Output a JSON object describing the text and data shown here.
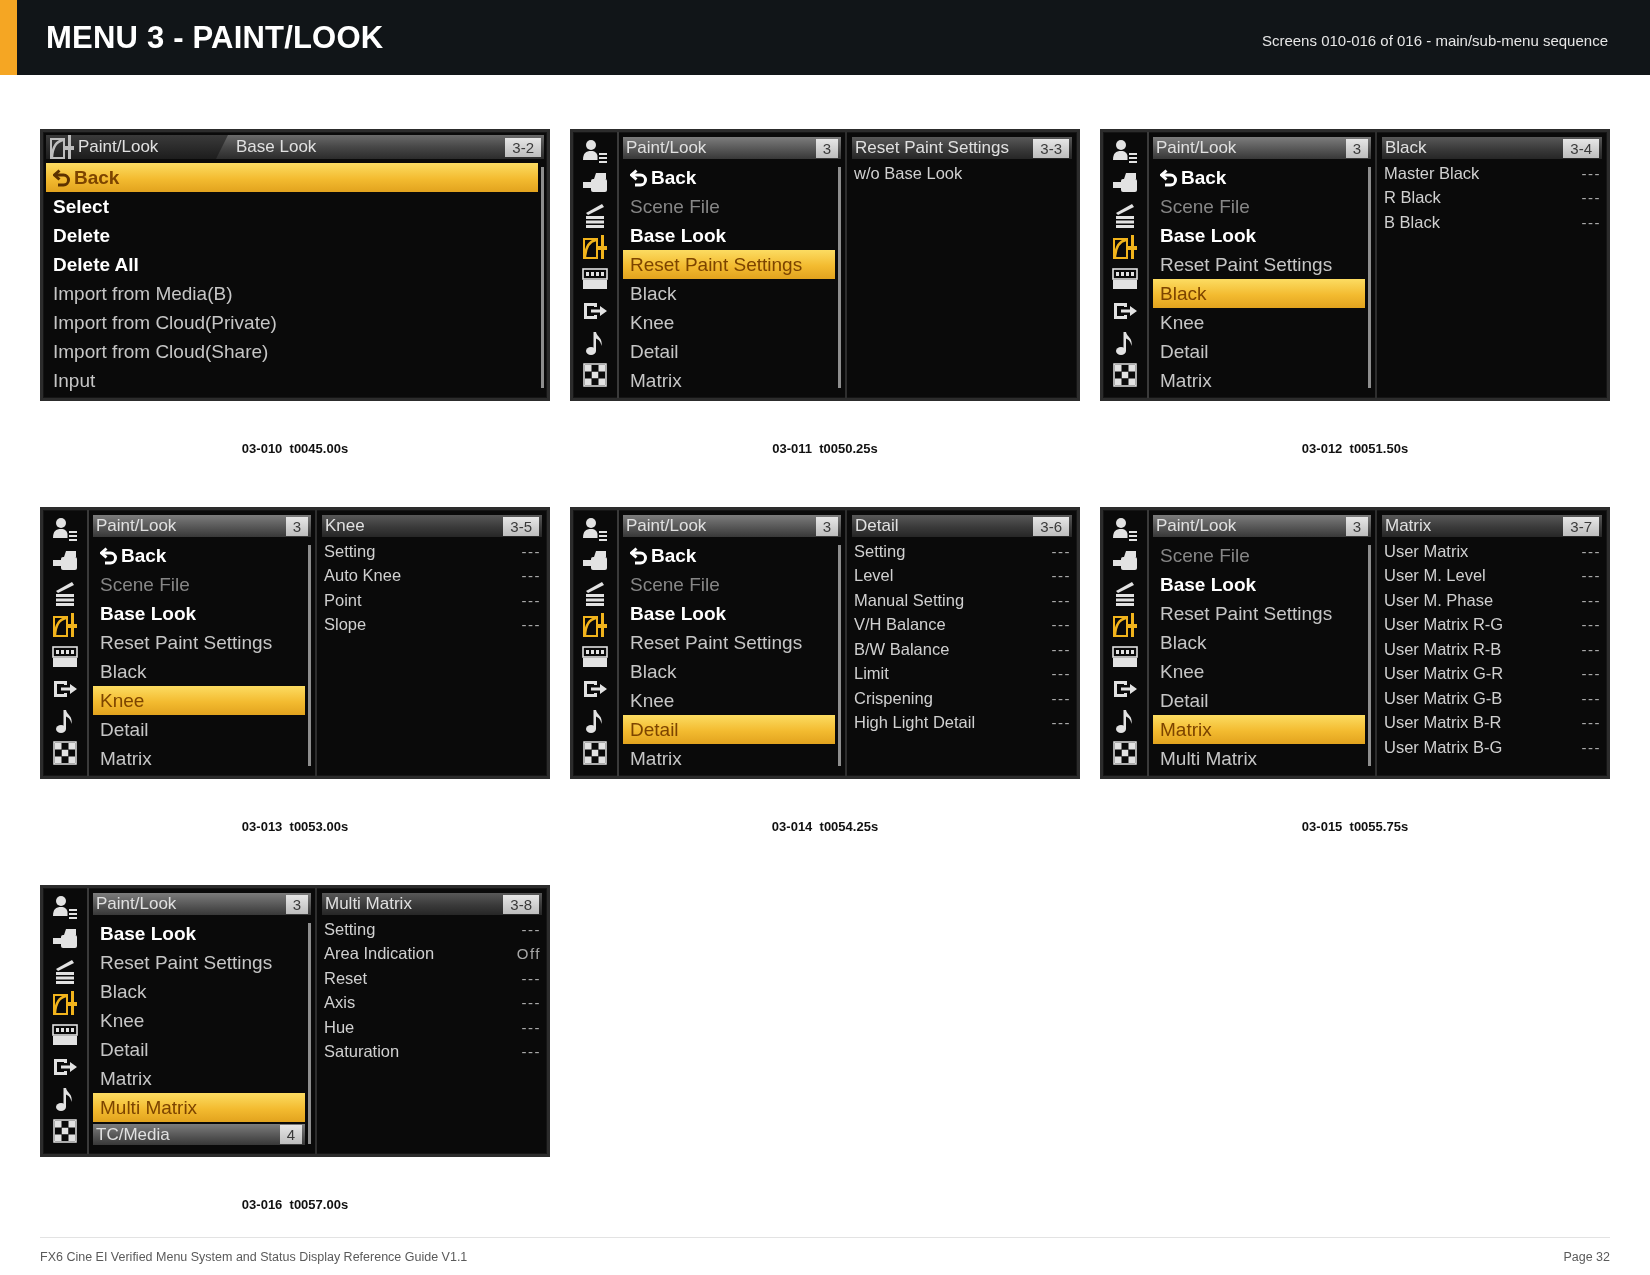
{
  "header": {
    "title": "MENU 3 - PAINT/LOOK",
    "subtitle": "Screens 010-016 of 016 - main/sub-menu sequence"
  },
  "screens": [
    {
      "kind": "single",
      "menu": {
        "section": "Paint/Look",
        "title": "Base Look",
        "number": "3-2",
        "items": [
          {
            "kind": "back",
            "label": "Back",
            "emphasized": true,
            "disabled": false,
            "selected": true
          },
          {
            "kind": "item",
            "label": "Select",
            "emphasized": true,
            "disabled": false,
            "selected": false
          },
          {
            "kind": "item",
            "label": "Delete",
            "emphasized": true,
            "disabled": false,
            "selected": false
          },
          {
            "kind": "item",
            "label": "Delete All",
            "emphasized": true,
            "disabled": false,
            "selected": false
          },
          {
            "kind": "item",
            "label": "Import from Media(B)",
            "emphasized": false,
            "disabled": false,
            "selected": false
          },
          {
            "kind": "item",
            "label": "Import from Cloud(Private)",
            "emphasized": false,
            "disabled": false,
            "selected": false
          },
          {
            "kind": "item",
            "label": "Import from Cloud(Share)",
            "emphasized": false,
            "disabled": false,
            "selected": false
          },
          {
            "kind": "item",
            "label": "Input",
            "emphasized": false,
            "disabled": false,
            "selected": false
          }
        ]
      },
      "caption": "03-010  t0045.00s"
    },
    {
      "kind": "split",
      "side_icons": [
        {
          "kind": "user",
          "selected": false
        },
        {
          "kind": "camera",
          "selected": false
        },
        {
          "kind": "clapper",
          "selected": false
        },
        {
          "kind": "paint",
          "selected": true
        },
        {
          "kind": "timecode",
          "selected": false
        },
        {
          "kind": "output",
          "selected": false
        },
        {
          "kind": "audio",
          "selected": false
        },
        {
          "kind": "grid",
          "selected": false
        }
      ],
      "menu": {
        "title": "Paint/Look",
        "number": "3",
        "items": [
          {
            "kind": "back",
            "label": "Back",
            "emphasized": true,
            "disabled": false,
            "selected": false
          },
          {
            "kind": "item",
            "label": "Scene File",
            "emphasized": false,
            "disabled": true,
            "selected": false
          },
          {
            "kind": "item",
            "label": "Base Look",
            "emphasized": true,
            "disabled": false,
            "selected": false
          },
          {
            "kind": "item",
            "label": "Reset Paint Settings",
            "emphasized": false,
            "disabled": false,
            "selected": true
          },
          {
            "kind": "item",
            "label": "Black",
            "emphasized": false,
            "disabled": false,
            "selected": false
          },
          {
            "kind": "item",
            "label": "Knee",
            "emphasized": false,
            "disabled": false,
            "selected": false
          },
          {
            "kind": "item",
            "label": "Detail",
            "emphasized": false,
            "disabled": false,
            "selected": false
          },
          {
            "kind": "item",
            "label": "Matrix",
            "emphasized": false,
            "disabled": false,
            "selected": false
          }
        ]
      },
      "submenu": {
        "title": "Reset Paint Settings",
        "number": "3-3",
        "items": [
          {
            "label": "w/o Base Look"
          }
        ]
      },
      "caption": "03-011  t0050.25s"
    },
    {
      "kind": "split",
      "side_icons": [
        {
          "kind": "user",
          "selected": false
        },
        {
          "kind": "camera",
          "selected": false
        },
        {
          "kind": "clapper",
          "selected": false
        },
        {
          "kind": "paint",
          "selected": true
        },
        {
          "kind": "timecode",
          "selected": false
        },
        {
          "kind": "output",
          "selected": false
        },
        {
          "kind": "audio",
          "selected": false
        },
        {
          "kind": "grid",
          "selected": false
        }
      ],
      "menu": {
        "title": "Paint/Look",
        "number": "3",
        "items": [
          {
            "kind": "back",
            "label": "Back",
            "emphasized": true,
            "disabled": false,
            "selected": false
          },
          {
            "kind": "item",
            "label": "Scene File",
            "emphasized": false,
            "disabled": true,
            "selected": false
          },
          {
            "kind": "item",
            "label": "Base Look",
            "emphasized": true,
            "disabled": false,
            "selected": false
          },
          {
            "kind": "item",
            "label": "Reset Paint Settings",
            "emphasized": false,
            "disabled": false,
            "selected": false
          },
          {
            "kind": "item",
            "label": "Black",
            "emphasized": false,
            "disabled": false,
            "selected": true
          },
          {
            "kind": "item",
            "label": "Knee",
            "emphasized": false,
            "disabled": false,
            "selected": false
          },
          {
            "kind": "item",
            "label": "Detail",
            "emphasized": false,
            "disabled": false,
            "selected": false
          },
          {
            "kind": "item",
            "label": "Matrix",
            "emphasized": false,
            "disabled": false,
            "selected": false
          }
        ]
      },
      "submenu": {
        "title": "Black",
        "number": "3-4",
        "items": [
          {
            "label": "Master Black",
            "value": "---"
          },
          {
            "label": "R Black",
            "value": "---"
          },
          {
            "label": "B Black",
            "value": "---"
          }
        ]
      },
      "caption": "03-012  t0051.50s"
    },
    {
      "kind": "split",
      "side_icons": [
        {
          "kind": "user",
          "selected": false
        },
        {
          "kind": "camera",
          "selected": false
        },
        {
          "kind": "clapper",
          "selected": false
        },
        {
          "kind": "paint",
          "selected": true
        },
        {
          "kind": "timecode",
          "selected": false
        },
        {
          "kind": "output",
          "selected": false
        },
        {
          "kind": "audio",
          "selected": false
        },
        {
          "kind": "grid",
          "selected": false
        }
      ],
      "menu": {
        "title": "Paint/Look",
        "number": "3",
        "items": [
          {
            "kind": "back",
            "label": "Back",
            "emphasized": true,
            "disabled": false,
            "selected": false
          },
          {
            "kind": "item",
            "label": "Scene File",
            "emphasized": false,
            "disabled": true,
            "selected": false
          },
          {
            "kind": "item",
            "label": "Base Look",
            "emphasized": true,
            "disabled": false,
            "selected": false
          },
          {
            "kind": "item",
            "label": "Reset Paint Settings",
            "emphasized": false,
            "disabled": false,
            "selected": false
          },
          {
            "kind": "item",
            "label": "Black",
            "emphasized": false,
            "disabled": false,
            "selected": false
          },
          {
            "kind": "item",
            "label": "Knee",
            "emphasized": false,
            "disabled": false,
            "selected": true
          },
          {
            "kind": "item",
            "label": "Detail",
            "emphasized": false,
            "disabled": false,
            "selected": false
          },
          {
            "kind": "item",
            "label": "Matrix",
            "emphasized": false,
            "disabled": false,
            "selected": false
          }
        ]
      },
      "submenu": {
        "title": "Knee",
        "number": "3-5",
        "items": [
          {
            "label": "Setting",
            "value": "---"
          },
          {
            "label": "Auto Knee",
            "value": "---"
          },
          {
            "label": "Point",
            "value": "---"
          },
          {
            "label": "Slope",
            "value": "---"
          }
        ]
      },
      "caption": "03-013  t0053.00s"
    },
    {
      "kind": "split",
      "side_icons": [
        {
          "kind": "user",
          "selected": false
        },
        {
          "kind": "camera",
          "selected": false
        },
        {
          "kind": "clapper",
          "selected": false
        },
        {
          "kind": "paint",
          "selected": true
        },
        {
          "kind": "timecode",
          "selected": false
        },
        {
          "kind": "output",
          "selected": false
        },
        {
          "kind": "audio",
          "selected": false
        },
        {
          "kind": "grid",
          "selected": false
        }
      ],
      "menu": {
        "title": "Paint/Look",
        "number": "3",
        "items": [
          {
            "kind": "back",
            "label": "Back",
            "emphasized": true,
            "disabled": false,
            "selected": false
          },
          {
            "kind": "item",
            "label": "Scene File",
            "emphasized": false,
            "disabled": true,
            "selected": false
          },
          {
            "kind": "item",
            "label": "Base Look",
            "emphasized": true,
            "disabled": false,
            "selected": false
          },
          {
            "kind": "item",
            "label": "Reset Paint Settings",
            "emphasized": false,
            "disabled": false,
            "selected": false
          },
          {
            "kind": "item",
            "label": "Black",
            "emphasized": false,
            "disabled": false,
            "selected": false
          },
          {
            "kind": "item",
            "label": "Knee",
            "emphasized": false,
            "disabled": false,
            "selected": false
          },
          {
            "kind": "item",
            "label": "Detail",
            "emphasized": false,
            "disabled": false,
            "selected": true
          },
          {
            "kind": "item",
            "label": "Matrix",
            "emphasized": false,
            "disabled": false,
            "selected": false
          }
        ]
      },
      "submenu": {
        "title": "Detail",
        "number": "3-6",
        "items": [
          {
            "label": "Setting",
            "value": "---"
          },
          {
            "label": "Level",
            "value": "---"
          },
          {
            "label": "Manual Setting",
            "value": "---"
          },
          {
            "label": "V/H Balance",
            "value": "---"
          },
          {
            "label": "B/W Balance",
            "value": "---"
          },
          {
            "label": "Limit",
            "value": "---"
          },
          {
            "label": "Crispening",
            "value": "---"
          },
          {
            "label": "High Light Detail",
            "value": "---"
          }
        ]
      },
      "caption": "03-014  t0054.25s"
    },
    {
      "kind": "split",
      "side_icons": [
        {
          "kind": "user",
          "selected": false
        },
        {
          "kind": "camera",
          "selected": false
        },
        {
          "kind": "clapper",
          "selected": false
        },
        {
          "kind": "paint",
          "selected": true
        },
        {
          "kind": "timecode",
          "selected": false
        },
        {
          "kind": "output",
          "selected": false
        },
        {
          "kind": "audio",
          "selected": false
        },
        {
          "kind": "grid",
          "selected": false
        }
      ],
      "menu": {
        "title": "Paint/Look",
        "number": "3",
        "items": [
          {
            "kind": "item",
            "label": "Scene File",
            "emphasized": false,
            "disabled": true,
            "selected": false
          },
          {
            "kind": "item",
            "label": "Base Look",
            "emphasized": true,
            "disabled": false,
            "selected": false
          },
          {
            "kind": "item",
            "label": "Reset Paint Settings",
            "emphasized": false,
            "disabled": false,
            "selected": false
          },
          {
            "kind": "item",
            "label": "Black",
            "emphasized": false,
            "disabled": false,
            "selected": false
          },
          {
            "kind": "item",
            "label": "Knee",
            "emphasized": false,
            "disabled": false,
            "selected": false
          },
          {
            "kind": "item",
            "label": "Detail",
            "emphasized": false,
            "disabled": false,
            "selected": false
          },
          {
            "kind": "item",
            "label": "Matrix",
            "emphasized": false,
            "disabled": false,
            "selected": true
          },
          {
            "kind": "item",
            "label": "Multi Matrix",
            "emphasized": false,
            "disabled": false,
            "selected": false
          }
        ]
      },
      "submenu": {
        "title": "Matrix",
        "number": "3-7",
        "items": [
          {
            "label": "User Matrix",
            "value": "---"
          },
          {
            "label": "User M. Level",
            "value": "---"
          },
          {
            "label": "User M. Phase",
            "value": "---"
          },
          {
            "label": "User Matrix R-G",
            "value": "---"
          },
          {
            "label": "User Matrix R-B",
            "value": "---"
          },
          {
            "label": "User Matrix G-R",
            "value": "---"
          },
          {
            "label": "User Matrix G-B",
            "value": "---"
          },
          {
            "label": "User Matrix B-R",
            "value": "---"
          },
          {
            "label": "User Matrix B-G",
            "value": "---"
          }
        ]
      },
      "caption": "03-015  t0055.75s"
    },
    {
      "kind": "split",
      "side_icons": [
        {
          "kind": "user",
          "selected": false
        },
        {
          "kind": "camera",
          "selected": false
        },
        {
          "kind": "clapper",
          "selected": false
        },
        {
          "kind": "paint",
          "selected": true
        },
        {
          "kind": "timecode",
          "selected": false
        },
        {
          "kind": "output",
          "selected": false
        },
        {
          "kind": "audio",
          "selected": false
        },
        {
          "kind": "grid",
          "selected": false
        }
      ],
      "menu": {
        "title": "Paint/Look",
        "number": "3",
        "items": [
          {
            "kind": "item",
            "label": "Base Look",
            "emphasized": true,
            "disabled": false,
            "selected": false
          },
          {
            "kind": "item",
            "label": "Reset Paint Settings",
            "emphasized": false,
            "disabled": false,
            "selected": false
          },
          {
            "kind": "item",
            "label": "Black",
            "emphasized": false,
            "disabled": false,
            "selected": false
          },
          {
            "kind": "item",
            "label": "Knee",
            "emphasized": false,
            "disabled": false,
            "selected": false
          },
          {
            "kind": "item",
            "label": "Detail",
            "emphasized": false,
            "disabled": false,
            "selected": false
          },
          {
            "kind": "item",
            "label": "Matrix",
            "emphasized": false,
            "disabled": false,
            "selected": false
          },
          {
            "kind": "item",
            "label": "Multi Matrix",
            "emphasized": false,
            "disabled": false,
            "selected": true
          }
        ],
        "next": {
          "title": "TC/Media",
          "number": "4"
        }
      },
      "submenu": {
        "title": "Multi Matrix",
        "number": "3-8",
        "items": [
          {
            "label": "Setting",
            "value": "---"
          },
          {
            "label": "Area Indication",
            "value": "Off"
          },
          {
            "label": "Reset",
            "value": "---"
          },
          {
            "label": "Axis",
            "value": "---"
          },
          {
            "label": "Hue",
            "value": "---"
          },
          {
            "label": "Saturation",
            "value": "---"
          }
        ]
      },
      "caption": "03-016  t0057.00s"
    }
  ],
  "footer": {
    "title": "FX6 Cine EI Verified Menu System and Status Display Reference Guide V1.1",
    "page": "Page 32"
  }
}
